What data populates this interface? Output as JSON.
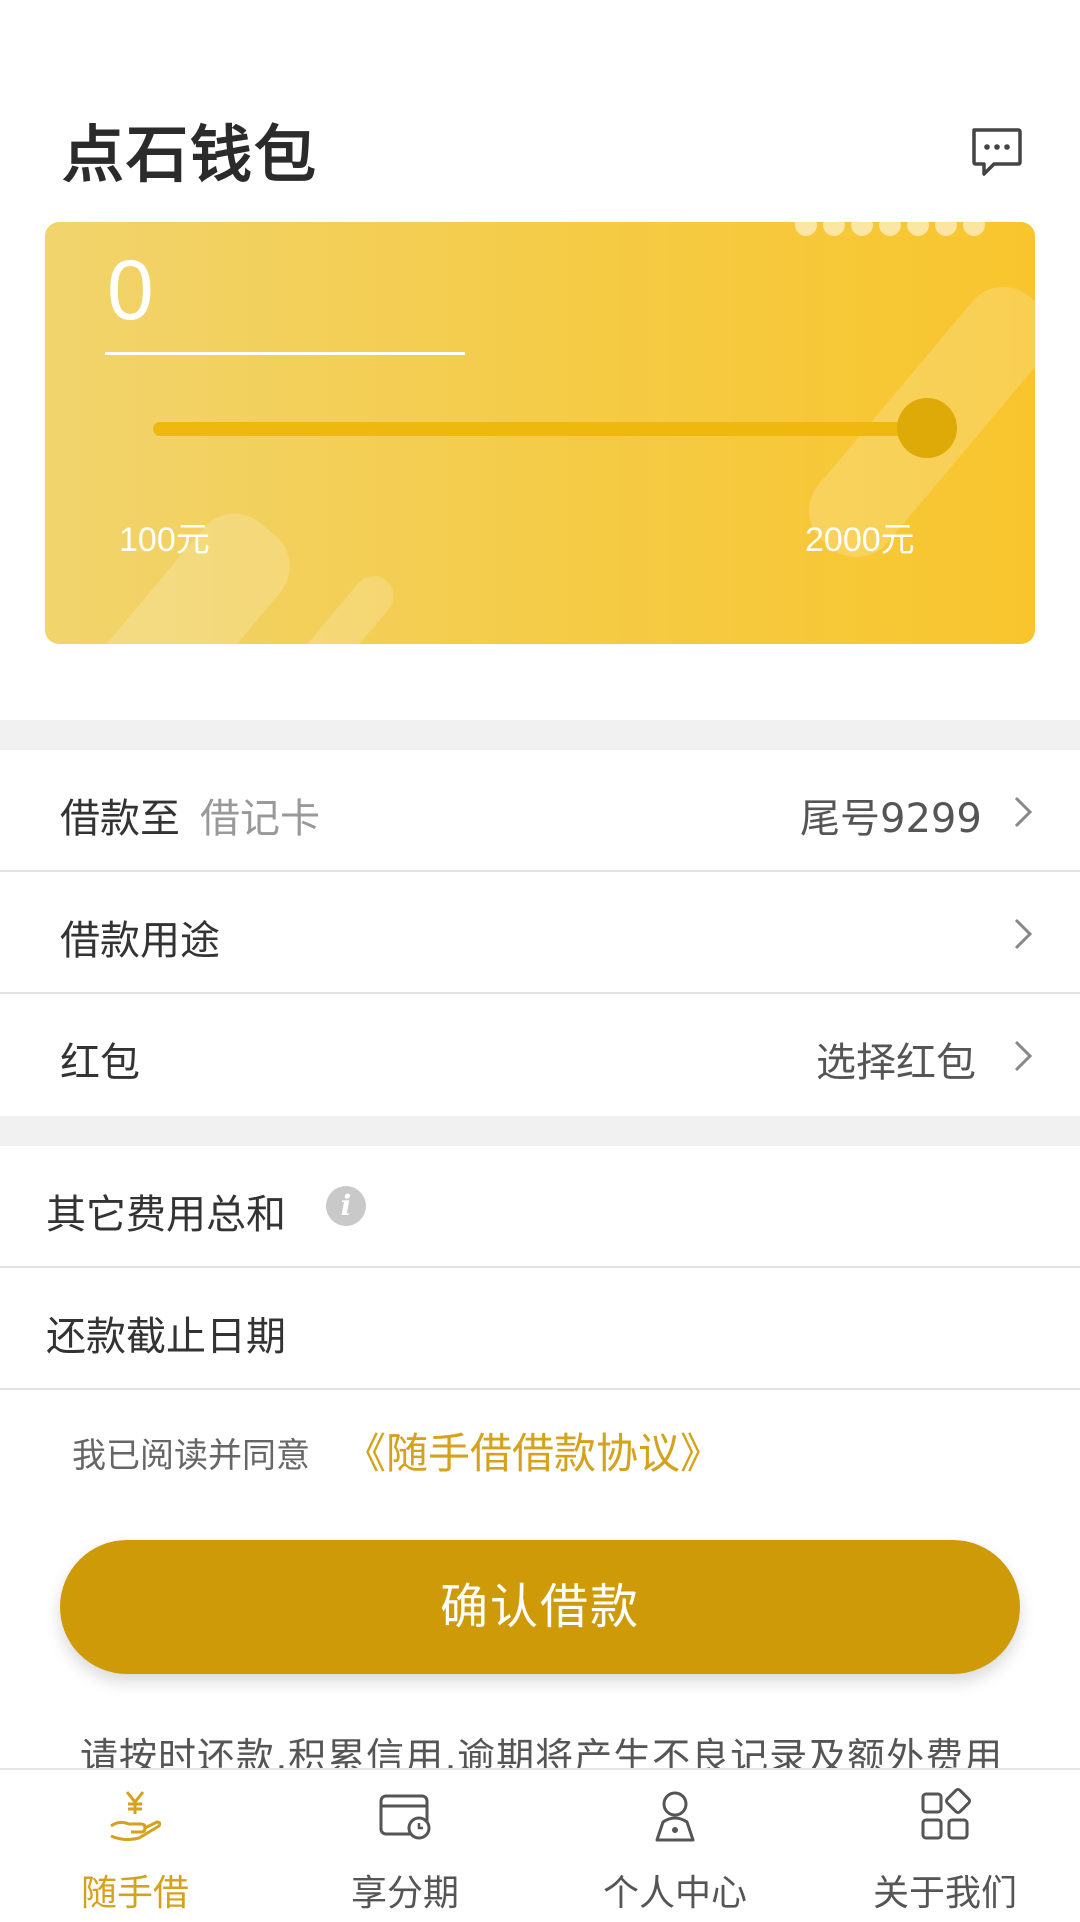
{
  "header": {
    "title": "点石钱包",
    "message_icon": "message-icon"
  },
  "loan_card": {
    "amount": "0",
    "slider_value_fraction": 1.0,
    "min_label": "100元",
    "max_label": "2000元"
  },
  "rows": {
    "bank": {
      "label": "借款至",
      "sub": "借记卡",
      "value": "尾号9299"
    },
    "purpose": {
      "label": "借款用途"
    },
    "redpacket": {
      "label": "红包",
      "value": "选择红包"
    },
    "fees": {
      "label": "其它费用总和",
      "info_glyph": "i"
    },
    "due_date": {
      "label": "还款截止日期"
    }
  },
  "agreement": {
    "text": "我已阅读并同意",
    "link": "《随手借借款协议》"
  },
  "confirm_button": "确认借款",
  "notice": "请按时还款,积累信用,逾期将产生不良记录及额外费用",
  "tabs": [
    {
      "label": "随手借",
      "icon": "hand-yen-icon",
      "active": true
    },
    {
      "label": "享分期",
      "icon": "wallet-clock-icon",
      "active": false
    },
    {
      "label": "个人中心",
      "icon": "user-icon",
      "active": false
    },
    {
      "label": "关于我们",
      "icon": "apps-grid-icon",
      "active": false
    }
  ],
  "colors": {
    "accent": "#cf9a08",
    "card_yellow": "#f5cb45",
    "link": "#d4a21c"
  }
}
